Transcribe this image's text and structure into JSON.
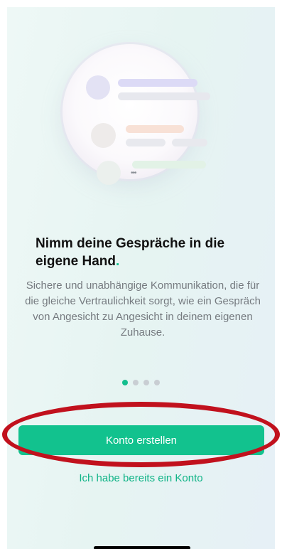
{
  "onboarding": {
    "headline": "Nimm deine Gespräche in die eigene Hand",
    "headline_punct": ".",
    "description": "Sichere und unabhängige Kommunikation, die für die gleiche Vertraulichkeit sorgt, wie ein Gespräch von Angesicht zu Angesicht in deinem eigenen Zuhause.",
    "illustration_ellipsis": "•••",
    "page_indicator": {
      "current": 1,
      "total": 4
    },
    "create_account_label": "Konto erstellen",
    "login_label": "Ich habe bereits ein Konto"
  },
  "colors": {
    "accent": "#12c28e",
    "highlight": "#c1111d"
  }
}
